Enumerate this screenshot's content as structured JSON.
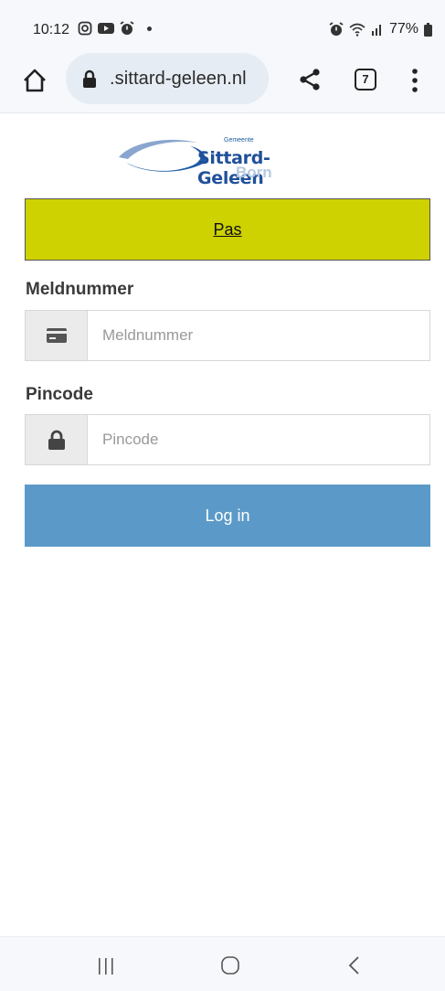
{
  "status_bar": {
    "time": "10:12",
    "battery": "77%",
    "left_icons": [
      "instagram-icon",
      "youtube-icon",
      "alarm-icon",
      "dot-icon"
    ],
    "right_icons": [
      "alarm-icon",
      "wifi-icon",
      "signal-icon",
      "battery-icon"
    ]
  },
  "browser": {
    "url": ".sittard-geleen.nl",
    "tab_count": "7",
    "icons": [
      "home-icon",
      "lock-icon",
      "share-icon",
      "tabs-icon",
      "more-vert-icon"
    ]
  },
  "logo": {
    "small_text": "Gemeente",
    "main_text": "Sittard-Geleen",
    "sub_text": "Born"
  },
  "banner": {
    "link": "Pas",
    "color": "#cdd200"
  },
  "form": {
    "meldnummer_label": "Meldnummer",
    "meldnummer_placeholder": "Meldnummer",
    "pincode_label": "Pincode",
    "pincode_placeholder": "Pincode",
    "login_label": "Log in",
    "login_color": "#5b9ac8"
  },
  "nav": {
    "icons": [
      "recent-apps-icon",
      "home-circle-icon",
      "back-icon"
    ]
  }
}
